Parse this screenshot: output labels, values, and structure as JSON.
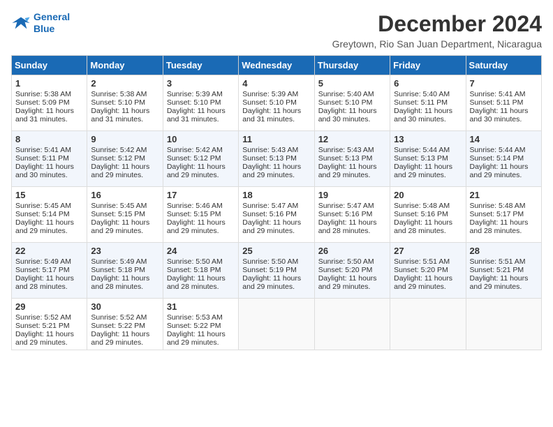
{
  "logo": {
    "line1": "General",
    "line2": "Blue"
  },
  "title": "December 2024",
  "subtitle": "Greytown, Rio San Juan Department, Nicaragua",
  "days_of_week": [
    "Sunday",
    "Monday",
    "Tuesday",
    "Wednesday",
    "Thursday",
    "Friday",
    "Saturday"
  ],
  "weeks": [
    [
      {
        "day": "1",
        "rise": "5:38 AM",
        "set": "5:09 PM",
        "daylight": "11 hours and 31 minutes."
      },
      {
        "day": "2",
        "rise": "5:38 AM",
        "set": "5:10 PM",
        "daylight": "11 hours and 31 minutes."
      },
      {
        "day": "3",
        "rise": "5:39 AM",
        "set": "5:10 PM",
        "daylight": "11 hours and 31 minutes."
      },
      {
        "day": "4",
        "rise": "5:39 AM",
        "set": "5:10 PM",
        "daylight": "11 hours and 31 minutes."
      },
      {
        "day": "5",
        "rise": "5:40 AM",
        "set": "5:10 PM",
        "daylight": "11 hours and 30 minutes."
      },
      {
        "day": "6",
        "rise": "5:40 AM",
        "set": "5:11 PM",
        "daylight": "11 hours and 30 minutes."
      },
      {
        "day": "7",
        "rise": "5:41 AM",
        "set": "5:11 PM",
        "daylight": "11 hours and 30 minutes."
      }
    ],
    [
      {
        "day": "8",
        "rise": "5:41 AM",
        "set": "5:11 PM",
        "daylight": "11 hours and 30 minutes."
      },
      {
        "day": "9",
        "rise": "5:42 AM",
        "set": "5:12 PM",
        "daylight": "11 hours and 29 minutes."
      },
      {
        "day": "10",
        "rise": "5:42 AM",
        "set": "5:12 PM",
        "daylight": "11 hours and 29 minutes."
      },
      {
        "day": "11",
        "rise": "5:43 AM",
        "set": "5:13 PM",
        "daylight": "11 hours and 29 minutes."
      },
      {
        "day": "12",
        "rise": "5:43 AM",
        "set": "5:13 PM",
        "daylight": "11 hours and 29 minutes."
      },
      {
        "day": "13",
        "rise": "5:44 AM",
        "set": "5:13 PM",
        "daylight": "11 hours and 29 minutes."
      },
      {
        "day": "14",
        "rise": "5:44 AM",
        "set": "5:14 PM",
        "daylight": "11 hours and 29 minutes."
      }
    ],
    [
      {
        "day": "15",
        "rise": "5:45 AM",
        "set": "5:14 PM",
        "daylight": "11 hours and 29 minutes."
      },
      {
        "day": "16",
        "rise": "5:45 AM",
        "set": "5:15 PM",
        "daylight": "11 hours and 29 minutes."
      },
      {
        "day": "17",
        "rise": "5:46 AM",
        "set": "5:15 PM",
        "daylight": "11 hours and 29 minutes."
      },
      {
        "day": "18",
        "rise": "5:47 AM",
        "set": "5:16 PM",
        "daylight": "11 hours and 29 minutes."
      },
      {
        "day": "19",
        "rise": "5:47 AM",
        "set": "5:16 PM",
        "daylight": "11 hours and 28 minutes."
      },
      {
        "day": "20",
        "rise": "5:48 AM",
        "set": "5:16 PM",
        "daylight": "11 hours and 28 minutes."
      },
      {
        "day": "21",
        "rise": "5:48 AM",
        "set": "5:17 PM",
        "daylight": "11 hours and 28 minutes."
      }
    ],
    [
      {
        "day": "22",
        "rise": "5:49 AM",
        "set": "5:17 PM",
        "daylight": "11 hours and 28 minutes."
      },
      {
        "day": "23",
        "rise": "5:49 AM",
        "set": "5:18 PM",
        "daylight": "11 hours and 28 minutes."
      },
      {
        "day": "24",
        "rise": "5:50 AM",
        "set": "5:18 PM",
        "daylight": "11 hours and 28 minutes."
      },
      {
        "day": "25",
        "rise": "5:50 AM",
        "set": "5:19 PM",
        "daylight": "11 hours and 29 minutes."
      },
      {
        "day": "26",
        "rise": "5:50 AM",
        "set": "5:20 PM",
        "daylight": "11 hours and 29 minutes."
      },
      {
        "day": "27",
        "rise": "5:51 AM",
        "set": "5:20 PM",
        "daylight": "11 hours and 29 minutes."
      },
      {
        "day": "28",
        "rise": "5:51 AM",
        "set": "5:21 PM",
        "daylight": "11 hours and 29 minutes."
      }
    ],
    [
      {
        "day": "29",
        "rise": "5:52 AM",
        "set": "5:21 PM",
        "daylight": "11 hours and 29 minutes."
      },
      {
        "day": "30",
        "rise": "5:52 AM",
        "set": "5:22 PM",
        "daylight": "11 hours and 29 minutes."
      },
      {
        "day": "31",
        "rise": "5:53 AM",
        "set": "5:22 PM",
        "daylight": "11 hours and 29 minutes."
      },
      null,
      null,
      null,
      null
    ]
  ]
}
